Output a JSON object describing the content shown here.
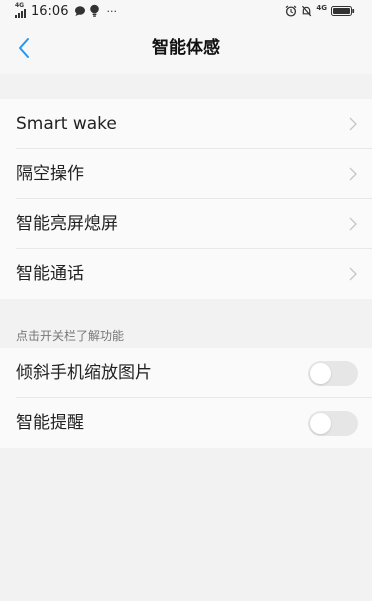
{
  "status_bar": {
    "network_label_left": "4G",
    "time": "16:06",
    "more": "···",
    "network_label_right": "4G"
  },
  "header": {
    "title": "智能体感"
  },
  "group_one": {
    "items": [
      {
        "label": "Smart wake"
      },
      {
        "label": "隔空操作"
      },
      {
        "label": "智能亮屏熄屏"
      },
      {
        "label": "智能通话"
      }
    ]
  },
  "group_two": {
    "section_label": "点击开关栏了解功能",
    "items": [
      {
        "label": "倾斜手机缩放图片",
        "enabled": false
      },
      {
        "label": "智能提醒",
        "enabled": false
      }
    ]
  },
  "colors": {
    "accent": "#2196f3",
    "background": "#f2f2f2",
    "row_background": "#fafafa",
    "toggle_off": "#e6e6e6"
  },
  "icons": [
    "signal-icon",
    "chat-bubble-icon",
    "notification-icon",
    "alarm-clock-icon",
    "mute-icon",
    "battery-icon",
    "back-arrow-icon",
    "chevron-right-icon"
  ]
}
